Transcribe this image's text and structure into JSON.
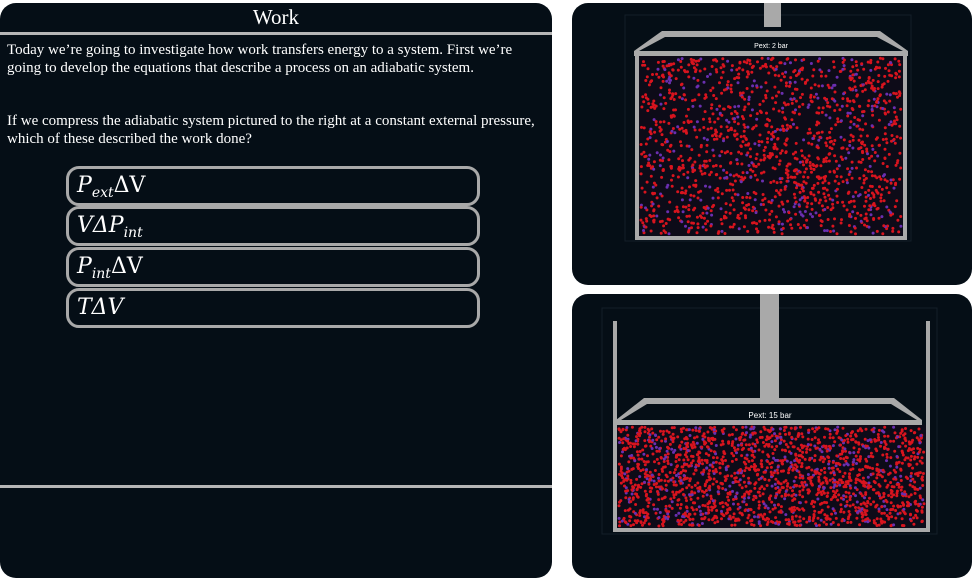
{
  "left_panel": {
    "title": "Work",
    "intro": "Today we’re going to investigate how work transfers energy to a system. First we’re going to develop the equations that describe a process on an adiabatic system.",
    "question": "If we compress the adiabatic system pictured to the right at a constant external pressure, which of these described the work done?",
    "choices": [
      {
        "symbol": "P",
        "subscript": "ext",
        "tail": "ΔV"
      },
      {
        "symbol": "VΔP",
        "subscript": "int",
        "tail": ""
      },
      {
        "symbol": "P",
        "subscript": "int",
        "tail": "ΔV"
      },
      {
        "symbol": "TΔV",
        "subscript": "",
        "tail": ""
      }
    ]
  },
  "simulations": {
    "top": {
      "pressure_label": "Pext: 2 bar"
    },
    "bottom": {
      "pressure_label": "Pext: 15 bar"
    }
  },
  "colors": {
    "panel_bg": "#050e16",
    "border_gray": "#a9a9a9",
    "particle_red": "#d8141e",
    "particle_purple": "#6a2fb0"
  }
}
